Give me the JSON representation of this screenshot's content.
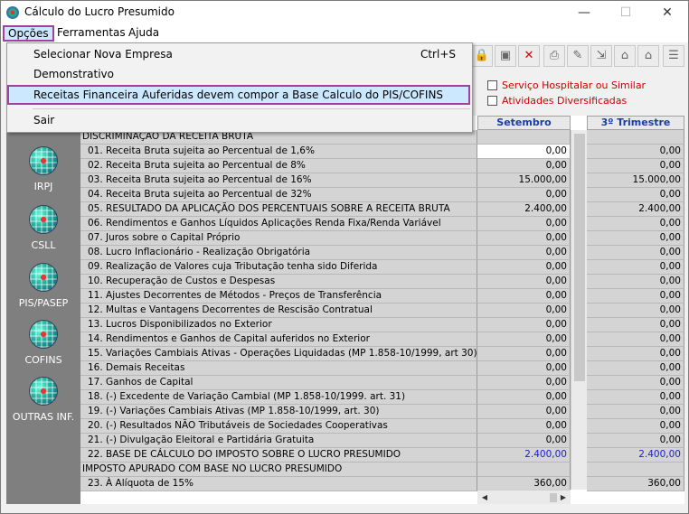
{
  "window": {
    "title": "Cálculo do Lucro Presumido",
    "controls": {
      "minimize": "—",
      "maximize": "☐",
      "close": "✕"
    }
  },
  "menubar": {
    "items": [
      "Opções",
      "Ferramentas",
      "Ajuda"
    ]
  },
  "dropdown": {
    "select_company": "Selecionar Nova Empresa",
    "select_company_shortcut": "Ctrl+S",
    "demonstrativo": "Demonstrativo",
    "receitas": "Receitas Financeira Auferidas devem compor a Base Calculo do PIS/COFINS",
    "sair": "Sair"
  },
  "toolbar": {
    "icons": [
      "lock-icon",
      "save-icon",
      "delete-icon",
      "print-icon",
      "wrench-icon",
      "export-icon",
      "house-icon",
      "house-icon-2",
      "list-icon"
    ]
  },
  "filters": {
    "servico": "Serviço Hospitalar ou Similar",
    "atividades": "Atividades Diversificadas"
  },
  "sidebar": {
    "items": [
      "IRPJ",
      "CSLL",
      "PIS/PASEP",
      "COFINS",
      "OUTRAS INF."
    ]
  },
  "grid": {
    "col_month": "Setembro",
    "col_quarter": "3º Trimestre",
    "rows": [
      {
        "desc": "DISCRIMINAÇÃO DA RECEITA BRUTA",
        "v1": "",
        "v2": ""
      },
      {
        "desc": "01. Receita Bruta sujeita ao Percentual de 1,6%",
        "v1": "0,00",
        "v2": "0,00"
      },
      {
        "desc": "02. Receita Bruta sujeita ao Percentual de 8%",
        "v1": "0,00",
        "v2": "0,00"
      },
      {
        "desc": "03. Receita Bruta sujeita ao Percentual de 16%",
        "v1": "15.000,00",
        "v2": "15.000,00"
      },
      {
        "desc": "04. Receita Bruta sujeita ao Percentual de 32%",
        "v1": "0,00",
        "v2": "0,00"
      },
      {
        "desc": "05. RESULTADO DA APLICAÇÃO DOS PERCENTUAIS SOBRE A RECEITA BRUTA",
        "v1": "2.400,00",
        "v2": "2.400,00"
      },
      {
        "desc": "06. Rendimentos e Ganhos Líquidos Aplicações Renda Fixa/Renda Variável",
        "v1": "0,00",
        "v2": "0,00"
      },
      {
        "desc": "07. Juros sobre o Capital Próprio",
        "v1": "0,00",
        "v2": "0,00"
      },
      {
        "desc": "08. Lucro Inflacionário - Realização Obrigatória",
        "v1": "0,00",
        "v2": "0,00"
      },
      {
        "desc": "09. Realização de Valores cuja Tributação tenha sido Diferida",
        "v1": "0,00",
        "v2": "0,00"
      },
      {
        "desc": "10. Recuperação de Custos e Despesas",
        "v1": "0,00",
        "v2": "0,00"
      },
      {
        "desc": "11. Ajustes Decorrentes de Métodos - Preços de Transferência",
        "v1": "0,00",
        "v2": "0,00"
      },
      {
        "desc": "12. Multas e Vantagens Decorrentes de Rescisão Contratual",
        "v1": "0,00",
        "v2": "0,00"
      },
      {
        "desc": "13. Lucros Disponibilizados no Exterior",
        "v1": "0,00",
        "v2": "0,00"
      },
      {
        "desc": "14. Rendimentos e Ganhos de Capital auferidos no Exterior",
        "v1": "0,00",
        "v2": "0,00"
      },
      {
        "desc": "15. Variações Cambiais Ativas - Operações Liquidadas (MP 1.858-10/1999, art 30)",
        "v1": "0,00",
        "v2": "0,00"
      },
      {
        "desc": "16. Demais Receitas",
        "v1": "0,00",
        "v2": "0,00"
      },
      {
        "desc": "17. Ganhos de Capital",
        "v1": "0,00",
        "v2": "0,00"
      },
      {
        "desc": "18. (-) Excedente de Variação Cambial (MP 1.858-10/1999. art. 31)",
        "v1": "0,00",
        "v2": "0,00"
      },
      {
        "desc": "19. (-) Variações Cambiais Ativas (MP 1.858-10/1999, art. 30)",
        "v1": "0,00",
        "v2": "0,00"
      },
      {
        "desc": "20. (-) Resultados NÃO Tributáveis de Sociedades Cooperativas",
        "v1": "0,00",
        "v2": "0,00"
      },
      {
        "desc": "21. (-) Divulgação Eleitoral e Partidária Gratuita",
        "v1": "0,00",
        "v2": "0,00"
      },
      {
        "desc": "22. BASE DE CÁLCULO DO IMPOSTO SOBRE O LUCRO PRESUMIDO",
        "v1": "2.400,00",
        "v2": "2.400,00"
      },
      {
        "desc": "IMPOSTO APURADO COM BASE NO LUCRO PRESUMIDO",
        "v1": "",
        "v2": ""
      },
      {
        "desc": "23. À Alíquota de 15%",
        "v1": "360,00",
        "v2": "360,00"
      }
    ]
  }
}
